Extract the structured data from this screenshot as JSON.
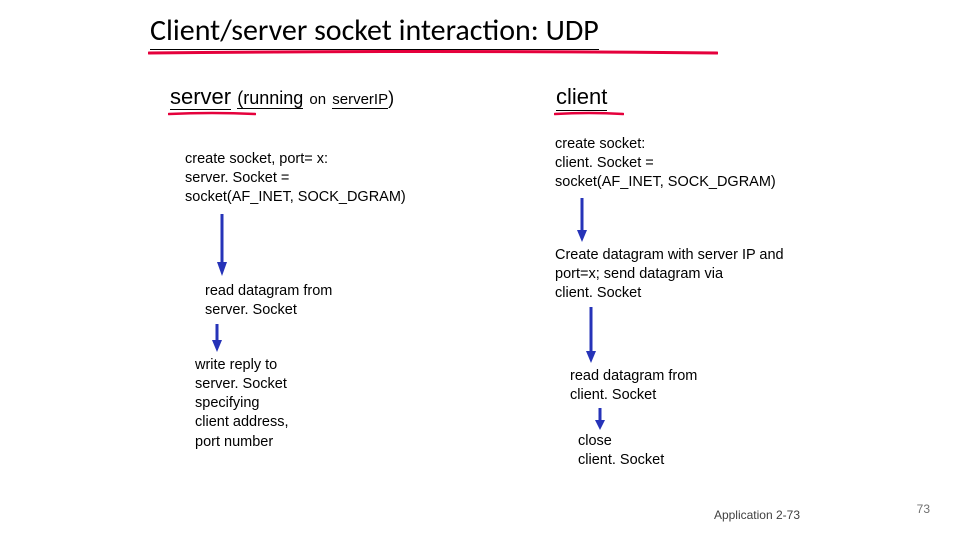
{
  "title": "Client/server socket interaction: UDP",
  "server": {
    "heading_main": "server",
    "heading_running": "(running",
    "heading_on": "on",
    "heading_ip": "serverIP",
    "heading_paren": ")",
    "step1_line1": "create socket, port= x:",
    "step1_line2": "server. Socket =",
    "step1_line3": "socket(AF_INET, SOCK_DGRAM)",
    "step2_line1": "read datagram from",
    "step2_line2": "server. Socket",
    "step3_line1": "write reply to",
    "step3_line2": "server. Socket",
    "step3_line3": "specifying",
    "step3_line4": "client address,",
    "step3_line5": "port number"
  },
  "client": {
    "heading": "client",
    "step1_line1": "create socket:",
    "step1_line2": "client. Socket =",
    "step1_line3": "socket(AF_INET, SOCK_DGRAM)",
    "step2_line1": "Create datagram with server IP and",
    "step2_line2": "port=x; send datagram via",
    "step2_line3": "client. Socket",
    "step3_line1": "read datagram from",
    "step3_line2": "client. Socket",
    "step4_line1": "close",
    "step4_line2": "client. Socket"
  },
  "footer": {
    "center": "Application  2-73",
    "page": "73"
  },
  "colors": {
    "accent_red": "#E5003C",
    "arrow_blue": "#2633B8"
  }
}
